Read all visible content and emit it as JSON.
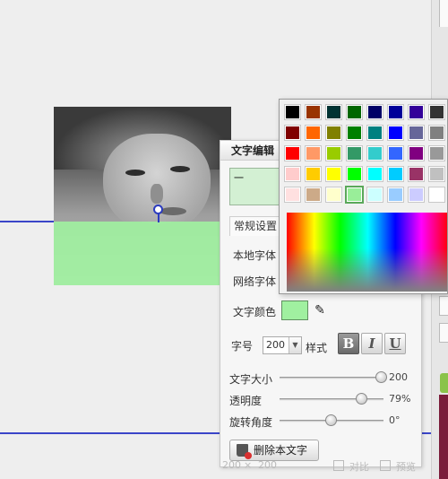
{
  "editor": {
    "title": "文字编辑",
    "text_value": "一",
    "tab_normal": "常规设置",
    "local_font_label": "本地字体",
    "web_font_label": "网络字体",
    "color_label": "文字颜色",
    "color_value": "#a0f0a0",
    "size_label": "字号",
    "size_value": "200",
    "style_label": "样式",
    "bold_label": "B",
    "italic_label": "I",
    "underline_label": "U",
    "sliders": [
      {
        "label": "文字大小",
        "value_text": "200",
        "fraction": 0.98
      },
      {
        "label": "透明度",
        "value_text": "79%",
        "fraction": 0.79
      },
      {
        "label": "旋转角度",
        "value_text": "0°",
        "fraction": 0.5
      }
    ],
    "delete_label": "删除本文字"
  },
  "status_bar": {
    "width": "200",
    "times": "×",
    "height": "200",
    "compare": "对比",
    "preview": "预览"
  },
  "palette": {
    "rows": [
      [
        "#000000",
        "#993300",
        "#003333",
        "#006600",
        "#000066",
        "#000099",
        "#330099",
        "#333333"
      ],
      [
        "#800000",
        "#ff6600",
        "#808000",
        "#008000",
        "#008080",
        "#0000ff",
        "#666699",
        "#808080"
      ],
      [
        "#ff0000",
        "#ff9966",
        "#99cc00",
        "#339966",
        "#33cccc",
        "#3366ff",
        "#800080",
        "#999999"
      ],
      [
        "#ffcccc",
        "#ffcc00",
        "#ffff00",
        "#00ff00",
        "#00ffff",
        "#00ccff",
        "#993366",
        "#c0c0c0"
      ],
      [
        "#ffe0e0",
        "#ccaa88",
        "#ffffcc",
        "#99ee99",
        "#ccffff",
        "#99ccff",
        "#ccccff",
        "#ffffff"
      ]
    ],
    "selected": "#99ee99"
  },
  "colors": {
    "guide_line": "#3a45c8",
    "text_overlay": "#a0f0a0"
  }
}
